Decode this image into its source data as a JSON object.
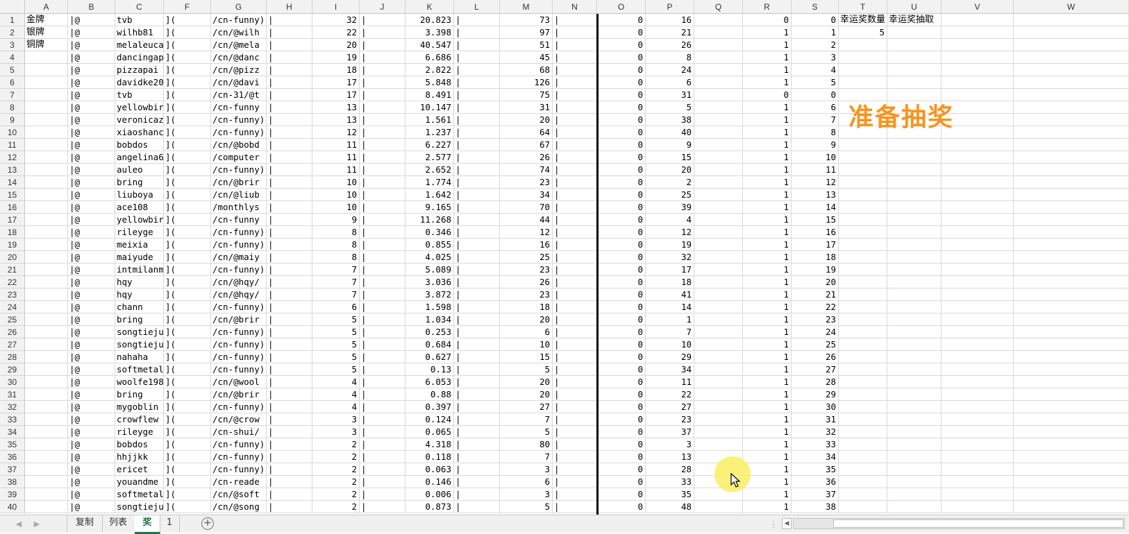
{
  "columns": [
    "A",
    "B",
    "C",
    "F",
    "G",
    "H",
    "I",
    "J",
    "K",
    "L",
    "M",
    "N",
    "O",
    "P",
    "Q",
    "R",
    "S",
    "T",
    "U",
    "V",
    "W"
  ],
  "medals": [
    "金牌",
    "银牌",
    "铜牌"
  ],
  "header_cells": {
    "t1": "幸运奖数量",
    "u1": "幸运奖抽取",
    "t2": "5"
  },
  "banner": "准备抽奖",
  "rows": [
    {
      "num": "1",
      "b": "|@",
      "c": "tvb",
      "f": "](",
      "g": "/cn-funny)",
      "h": "|",
      "i": "32",
      "j": "|",
      "k": "20.823",
      "l": "|",
      "m": "73",
      "n": "|",
      "o": "0",
      "p": "16",
      "r": "0",
      "s": "0"
    },
    {
      "num": "2",
      "b": "|@",
      "c": "wilhb81",
      "f": "](",
      "g": "/cn/@wilh",
      "h": "|",
      "i": "22",
      "j": "|",
      "k": "3.398",
      "l": "|",
      "m": "97",
      "n": "|",
      "o": "0",
      "p": "21",
      "r": "1",
      "s": "1"
    },
    {
      "num": "3",
      "b": "|@",
      "c": "melaleuca",
      "f": "](",
      "g": "/cn/@mela",
      "h": "|",
      "i": "20",
      "j": "|",
      "k": "40.547",
      "l": "|",
      "m": "51",
      "n": "|",
      "o": "0",
      "p": "26",
      "r": "1",
      "s": "2"
    },
    {
      "num": "4",
      "b": "|@",
      "c": "dancingap",
      "f": "](",
      "g": "/cn/@danc",
      "h": "|",
      "i": "19",
      "j": "|",
      "k": "6.686",
      "l": "|",
      "m": "45",
      "n": "|",
      "o": "0",
      "p": "8",
      "r": "1",
      "s": "3"
    },
    {
      "num": "5",
      "b": "|@",
      "c": "pizzapai",
      "f": "](",
      "g": "/cn/@pizz",
      "h": "|",
      "i": "18",
      "j": "|",
      "k": "2.822",
      "l": "|",
      "m": "68",
      "n": "|",
      "o": "0",
      "p": "24",
      "r": "1",
      "s": "4"
    },
    {
      "num": "6",
      "b": "|@",
      "c": "davidke20",
      "f": "](",
      "g": "/cn/@davi",
      "h": "|",
      "i": "17",
      "j": "|",
      "k": "5.848",
      "l": "|",
      "m": "126",
      "n": "|",
      "o": "0",
      "p": "6",
      "r": "1",
      "s": "5"
    },
    {
      "num": "7",
      "b": "|@",
      "c": "tvb",
      "f": "](",
      "g": "/cn-31/@t",
      "h": "|",
      "i": "17",
      "j": "|",
      "k": "8.491",
      "l": "|",
      "m": "75",
      "n": "|",
      "o": "0",
      "p": "31",
      "r": "0",
      "s": "0"
    },
    {
      "num": "8",
      "b": "|@",
      "c": "yellowbir",
      "f": "](",
      "g": "/cn-funny",
      "h": "|",
      "i": "13",
      "j": "|",
      "k": "10.147",
      "l": "|",
      "m": "31",
      "n": "|",
      "o": "0",
      "p": "5",
      "r": "1",
      "s": "6"
    },
    {
      "num": "9",
      "b": "|@",
      "c": "veronicaz",
      "f": "](",
      "g": "/cn-funny)",
      "h": "|",
      "i": "13",
      "j": "|",
      "k": "1.561",
      "l": "|",
      "m": "20",
      "n": "|",
      "o": "0",
      "p": "38",
      "r": "1",
      "s": "7"
    },
    {
      "num": "10",
      "b": "|@",
      "c": "xiaoshanc",
      "f": "](",
      "g": "/cn-funny)",
      "h": "|",
      "i": "12",
      "j": "|",
      "k": "1.237",
      "l": "|",
      "m": "64",
      "n": "|",
      "o": "0",
      "p": "40",
      "r": "1",
      "s": "8"
    },
    {
      "num": "11",
      "b": "|@",
      "c": "bobdos",
      "f": "](",
      "g": "/cn/@bobd",
      "h": "|",
      "i": "11",
      "j": "|",
      "k": "6.227",
      "l": "|",
      "m": "67",
      "n": "|",
      "o": "0",
      "p": "9",
      "r": "1",
      "s": "9"
    },
    {
      "num": "12",
      "b": "|@",
      "c": "angelina6",
      "f": "](",
      "g": "/computer",
      "h": "|",
      "i": "11",
      "j": "|",
      "k": "2.577",
      "l": "|",
      "m": "26",
      "n": "|",
      "o": "0",
      "p": "15",
      "r": "1",
      "s": "10"
    },
    {
      "num": "13",
      "b": "|@",
      "c": "auleo",
      "f": "](",
      "g": "/cn-funny)",
      "h": "|",
      "i": "11",
      "j": "|",
      "k": "2.652",
      "l": "|",
      "m": "74",
      "n": "|",
      "o": "0",
      "p": "20",
      "r": "1",
      "s": "11"
    },
    {
      "num": "14",
      "b": "|@",
      "c": "bring",
      "f": "](",
      "g": "/cn/@brir",
      "h": "|",
      "i": "10",
      "j": "|",
      "k": "1.774",
      "l": "|",
      "m": "23",
      "n": "|",
      "o": "0",
      "p": "2",
      "r": "1",
      "s": "12"
    },
    {
      "num": "15",
      "b": "|@",
      "c": "liuboya",
      "f": "](",
      "g": "/cn/@liub",
      "h": "|",
      "i": "10",
      "j": "|",
      "k": "1.642",
      "l": "|",
      "m": "34",
      "n": "|",
      "o": "0",
      "p": "25",
      "r": "1",
      "s": "13"
    },
    {
      "num": "16",
      "b": "|@",
      "c": "ace108",
      "f": "](",
      "g": "/monthlys",
      "h": "|",
      "i": "10",
      "j": "|",
      "k": "9.165",
      "l": "|",
      "m": "70",
      "n": "|",
      "o": "0",
      "p": "39",
      "r": "1",
      "s": "14"
    },
    {
      "num": "17",
      "b": "|@",
      "c": "yellowbir",
      "f": "](",
      "g": "/cn-funny",
      "h": "|",
      "i": "9",
      "j": "|",
      "k": "11.268",
      "l": "|",
      "m": "44",
      "n": "|",
      "o": "0",
      "p": "4",
      "r": "1",
      "s": "15"
    },
    {
      "num": "18",
      "b": "|@",
      "c": "rileyge",
      "f": "](",
      "g": "/cn-funny)",
      "h": "|",
      "i": "8",
      "j": "|",
      "k": "0.346",
      "l": "|",
      "m": "12",
      "n": "|",
      "o": "0",
      "p": "12",
      "r": "1",
      "s": "16"
    },
    {
      "num": "19",
      "b": "|@",
      "c": "meixia",
      "f": "](",
      "g": "/cn-funny)",
      "h": "|",
      "i": "8",
      "j": "|",
      "k": "0.855",
      "l": "|",
      "m": "16",
      "n": "|",
      "o": "0",
      "p": "19",
      "r": "1",
      "s": "17"
    },
    {
      "num": "20",
      "b": "|@",
      "c": "maiyude",
      "f": "](",
      "g": "/cn/@maiy",
      "h": "|",
      "i": "8",
      "j": "|",
      "k": "4.025",
      "l": "|",
      "m": "25",
      "n": "|",
      "o": "0",
      "p": "32",
      "r": "1",
      "s": "18"
    },
    {
      "num": "21",
      "b": "|@",
      "c": "intmilanm",
      "f": "](",
      "g": "/cn-funny)",
      "h": "|",
      "i": "7",
      "j": "|",
      "k": "5.089",
      "l": "|",
      "m": "23",
      "n": "|",
      "o": "0",
      "p": "17",
      "r": "1",
      "s": "19"
    },
    {
      "num": "22",
      "b": "|@",
      "c": "hqy",
      "f": "](",
      "g": "/cn/@hqy/",
      "h": "|",
      "i": "7",
      "j": "|",
      "k": "3.036",
      "l": "|",
      "m": "26",
      "n": "|",
      "o": "0",
      "p": "18",
      "r": "1",
      "s": "20"
    },
    {
      "num": "23",
      "b": "|@",
      "c": "hqy",
      "f": "](",
      "g": "/cn/@hqy/",
      "h": "|",
      "i": "7",
      "j": "|",
      "k": "3.872",
      "l": "|",
      "m": "23",
      "n": "|",
      "o": "0",
      "p": "41",
      "r": "1",
      "s": "21"
    },
    {
      "num": "24",
      "b": "|@",
      "c": "chann",
      "f": "](",
      "g": "/cn-funny)",
      "h": "|",
      "i": "6",
      "j": "|",
      "k": "1.598",
      "l": "|",
      "m": "18",
      "n": "|",
      "o": "0",
      "p": "14",
      "r": "1",
      "s": "22"
    },
    {
      "num": "25",
      "b": "|@",
      "c": "bring",
      "f": "](",
      "g": "/cn/@brir",
      "h": "|",
      "i": "5",
      "j": "|",
      "k": "1.034",
      "l": "|",
      "m": "20",
      "n": "|",
      "o": "0",
      "p": "1",
      "r": "1",
      "s": "23"
    },
    {
      "num": "26",
      "b": "|@",
      "c": "songtieju",
      "f": "](",
      "g": "/cn-funny)",
      "h": "|",
      "i": "5",
      "j": "|",
      "k": "0.253",
      "l": "|",
      "m": "6",
      "n": "|",
      "o": "0",
      "p": "7",
      "r": "1",
      "s": "24"
    },
    {
      "num": "27",
      "b": "|@",
      "c": "songtieju",
      "f": "](",
      "g": "/cn-funny)",
      "h": "|",
      "i": "5",
      "j": "|",
      "k": "0.684",
      "l": "|",
      "m": "10",
      "n": "|",
      "o": "0",
      "p": "10",
      "r": "1",
      "s": "25"
    },
    {
      "num": "28",
      "b": "|@",
      "c": "nahaha",
      "f": "](",
      "g": "/cn-funny)",
      "h": "|",
      "i": "5",
      "j": "|",
      "k": "0.627",
      "l": "|",
      "m": "15",
      "n": "|",
      "o": "0",
      "p": "29",
      "r": "1",
      "s": "26"
    },
    {
      "num": "29",
      "b": "|@",
      "c": "softmetal",
      "f": "](",
      "g": "/cn-funny)",
      "h": "|",
      "i": "5",
      "j": "|",
      "k": "0.13",
      "l": "|",
      "m": "5",
      "n": "|",
      "o": "0",
      "p": "34",
      "r": "1",
      "s": "27"
    },
    {
      "num": "30",
      "b": "|@",
      "c": "woolfe198",
      "f": "](",
      "g": "/cn/@wool",
      "h": "|",
      "i": "4",
      "j": "|",
      "k": "6.053",
      "l": "|",
      "m": "20",
      "n": "|",
      "o": "0",
      "p": "11",
      "r": "1",
      "s": "28"
    },
    {
      "num": "31",
      "b": "|@",
      "c": "bring",
      "f": "](",
      "g": "/cn/@brir",
      "h": "|",
      "i": "4",
      "j": "|",
      "k": "0.88",
      "l": "|",
      "m": "20",
      "n": "|",
      "o": "0",
      "p": "22",
      "r": "1",
      "s": "29"
    },
    {
      "num": "32",
      "b": "|@",
      "c": "mygoblin",
      "f": "](",
      "g": "/cn-funny)",
      "h": "|",
      "i": "4",
      "j": "|",
      "k": "0.397",
      "l": "|",
      "m": "27",
      "n": "|",
      "o": "0",
      "p": "27",
      "r": "1",
      "s": "30"
    },
    {
      "num": "33",
      "b": "|@",
      "c": "crowflew",
      "f": "](",
      "g": "/cn/@crow",
      "h": "|",
      "i": "3",
      "j": "|",
      "k": "0.124",
      "l": "|",
      "m": "7",
      "n": "|",
      "o": "0",
      "p": "23",
      "r": "1",
      "s": "31"
    },
    {
      "num": "34",
      "b": "|@",
      "c": "rileyge",
      "f": "](",
      "g": "/cn-shui/",
      "h": "|",
      "i": "3",
      "j": "|",
      "k": "0.065",
      "l": "|",
      "m": "5",
      "n": "|",
      "o": "0",
      "p": "37",
      "r": "1",
      "s": "32"
    },
    {
      "num": "35",
      "b": "|@",
      "c": "bobdos",
      "f": "](",
      "g": "/cn-funny)",
      "h": "|",
      "i": "2",
      "j": "|",
      "k": "4.318",
      "l": "|",
      "m": "80",
      "n": "|",
      "o": "0",
      "p": "3",
      "r": "1",
      "s": "33"
    },
    {
      "num": "36",
      "b": "|@",
      "c": "hhjjkk",
      "f": "](",
      "g": "/cn-funny)",
      "h": "|",
      "i": "2",
      "j": "|",
      "k": "0.118",
      "l": "|",
      "m": "7",
      "n": "|",
      "o": "0",
      "p": "13",
      "r": "1",
      "s": "34"
    },
    {
      "num": "37",
      "b": "|@",
      "c": "ericet",
      "f": "](",
      "g": "/cn-funny)",
      "h": "|",
      "i": "2",
      "j": "|",
      "k": "0.063",
      "l": "|",
      "m": "3",
      "n": "|",
      "o": "0",
      "p": "28",
      "r": "1",
      "s": "35"
    },
    {
      "num": "38",
      "b": "|@",
      "c": "youandme",
      "f": "](",
      "g": "/cn-reade",
      "h": "|",
      "i": "2",
      "j": "|",
      "k": "0.146",
      "l": "|",
      "m": "6",
      "n": "|",
      "o": "0",
      "p": "33",
      "r": "1",
      "s": "36"
    },
    {
      "num": "39",
      "b": "|@",
      "c": "softmetal",
      "f": "](",
      "g": "/cn/@soft",
      "h": "|",
      "i": "2",
      "j": "|",
      "k": "0.006",
      "l": "|",
      "m": "3",
      "n": "|",
      "o": "0",
      "p": "35",
      "r": "1",
      "s": "37"
    },
    {
      "num": "40",
      "b": "|@",
      "c": "songtieju",
      "f": "](",
      "g": "/cn/@song",
      "h": "|",
      "i": "2",
      "j": "|",
      "k": "0.873",
      "l": "|",
      "m": "5",
      "n": "|",
      "o": "0",
      "p": "48",
      "r": "1",
      "s": "38"
    }
  ],
  "sheet_tabs": [
    {
      "label": "复制",
      "active": false
    },
    {
      "label": "列表",
      "active": false
    },
    {
      "label": "奖",
      "active": true
    },
    {
      "label": "1",
      "active": false
    }
  ],
  "add_sheet_label": "+",
  "nav_prev": "◀",
  "nav_next": "▶",
  "scroll_left": "◀",
  "tab_separator": "⋮",
  "colors": {
    "accent": "#217346",
    "banner": "#f7941d",
    "cursor_highlight": "#f8f06a"
  }
}
